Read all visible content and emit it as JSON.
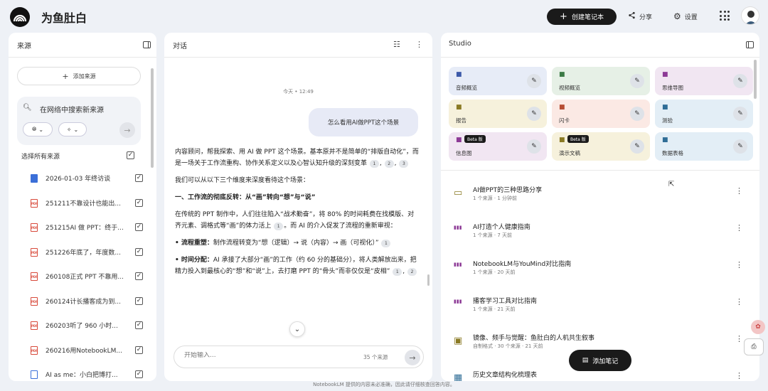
{
  "app": {
    "title": "为鱼肚白"
  },
  "header": {
    "create_label": "创建笔记本",
    "share_label": "分享",
    "settings_label": "设置"
  },
  "sources": {
    "title": "来源",
    "add_label": "添加来源",
    "search_text": "在网络中搜索新来源",
    "select_all": "选择所有来源",
    "items": [
      {
        "name": "2026-01-03 年终访谈",
        "type": "doc"
      },
      {
        "name": "251211不靠设计也能出...",
        "type": "pdf"
      },
      {
        "name": "251215AI 做 PPT：终于...",
        "type": "pdf"
      },
      {
        "name": "251226年底了，年度数...",
        "type": "pdf"
      },
      {
        "name": "260108正式 PPT 不靠用...",
        "type": "pdf"
      },
      {
        "name": "260124计长播客成为到...",
        "type": "pdf"
      },
      {
        "name": "260203听了 960 小时...",
        "type": "pdf"
      },
      {
        "name": "260216用NotebookLM...",
        "type": "pdf"
      },
      {
        "name": "AI as me：小白把博打...",
        "type": "txt"
      }
    ]
  },
  "chat": {
    "title": "对话",
    "time": "今天 • 12:49",
    "user_msg": "怎么看用AI做PPT这个场景",
    "p1": "内容顾问，帮我探索、用 AI 做 PPT 这个场景。基本原并不是简单的“排版自动化”，而是一场关于工作流重构、协作关系定义以及心智认知升级的深刻变革",
    "p1_cites": [
      "1",
      "2",
      "3"
    ],
    "p2": "我们可以从以下三个维度来深度看待这个场景：",
    "h1": "一、工作流的彻底反转：从“画”转向“想”与“说”",
    "p3": "在传统的 PPT 制作中，人们往往陷入“战术勤奋”，将 80% 的时间耗费在找模版、对齐元素、调格式等“画”的体力活上",
    "p3_tail": "。而 AI 的介入促发了流程的重新审视：",
    "p3_cite": "1",
    "b1_label": "• 流程重塑：",
    "b1_text": "制作流程转变为“想（逻辑）→ 说（内容）→ 画（可视化）”",
    "b1_cite": "1",
    "b2_label": "• 时间分配：",
    "b2_text": "AI 承接了大部分“画”的工作（约 60 分的基础分），将人类解放出来，把精力投入到最核心的“想”和“说”上，去打磨 PPT 的“骨头”而非仅仅是“皮相”",
    "b2_cites": [
      "1",
      "2"
    ],
    "input_placeholder": "开始输入...",
    "source_count": "35 个来源"
  },
  "studio": {
    "title": "Studio",
    "tiles": [
      {
        "label": "音频概览",
        "icon": "waveform-icon",
        "bg": "#e7ecf7",
        "ic": "#3d5aa9",
        "beta": ""
      },
      {
        "label": "视频概览",
        "icon": "video-icon",
        "bg": "#e6f0e6",
        "ic": "#3b7a45",
        "beta": ""
      },
      {
        "label": "思维导图",
        "icon": "mindmap-icon",
        "bg": "#f1e6f2",
        "ic": "#8d3a96",
        "beta": ""
      },
      {
        "label": "报告",
        "icon": "report-icon",
        "bg": "#f6f1dc",
        "ic": "#8a7a24",
        "beta": ""
      },
      {
        "label": "闪卡",
        "icon": "flashcard-icon",
        "bg": "#fbe9e4",
        "ic": "#b64d33",
        "beta": ""
      },
      {
        "label": "测验",
        "icon": "quiz-icon",
        "bg": "#e3eef6",
        "ic": "#2f6d96",
        "beta": ""
      },
      {
        "label": "信息图",
        "icon": "infographic-icon",
        "bg": "#f1e6f2",
        "ic": "#8d3a96",
        "beta": "Beta 版"
      },
      {
        "label": "演示文稿",
        "icon": "slides-icon",
        "bg": "#f6f1dc",
        "ic": "#8a7a24",
        "beta": "Beta 版"
      },
      {
        "label": "数据表格",
        "icon": "table-icon",
        "bg": "#e3eef6",
        "ic": "#2f6d96",
        "beta": ""
      }
    ],
    "notes": [
      {
        "title": "AI做PPT的三种思路分享",
        "sub": "1 个来源 · 1 分钟前",
        "icon": "slides-icon",
        "color": "#8a7a24"
      },
      {
        "title": "AI打造个人健康指南",
        "sub": "1 个来源 · 7 天前",
        "icon": "audio-bars-icon",
        "color": "#8d3a96"
      },
      {
        "title": "NotebookLM与YouMind对比指南",
        "sub": "1 个来源 · 20 天前",
        "icon": "audio-bars-icon",
        "color": "#8d3a96"
      },
      {
        "title": "播客学习工具对比指南",
        "sub": "1 个来源 · 21 天前",
        "icon": "audio-bars-icon",
        "color": "#8d3a96"
      },
      {
        "title": "镜像、频手与觉醒：鱼肚白的人机共生叙事",
        "sub": "自制格式 · 30 个来源 · 21 天前",
        "icon": "report-icon",
        "color": "#8a7a24"
      },
      {
        "title": "历史文章结构化梳理表",
        "sub": "",
        "icon": "table-icon",
        "color": "#2f6d96"
      }
    ],
    "add_note_label": "添加笔记"
  },
  "footer": {
    "text": "NotebookLM 提供的内容未必准确，因此请仔细核查回答内容。"
  }
}
